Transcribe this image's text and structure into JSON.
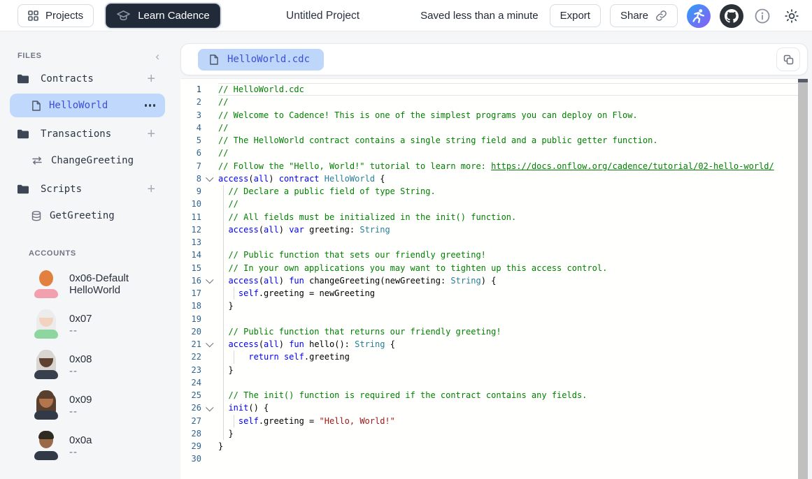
{
  "topbar": {
    "projects_label": "Projects",
    "learn_cadence_label": "Learn Cadence",
    "project_title": "Untitled Project",
    "save_status": "Saved less than a minute",
    "export_label": "Export",
    "share_label": "Share"
  },
  "icons": {
    "plus": "+",
    "collapse_chevron": "‹"
  },
  "sidebar": {
    "files_header": "FILES",
    "accounts_header": "ACCOUNTS",
    "sections": [
      {
        "label": "Contracts",
        "icon": "folder-icon",
        "items": [
          {
            "label": "HelloWorld",
            "icon": "file-icon",
            "selected": true,
            "has_menu": true
          }
        ]
      },
      {
        "label": "Transactions",
        "icon": "folder-icon",
        "items": [
          {
            "label": "ChangeGreeting",
            "icon": "transaction-arrows-icon",
            "selected": false,
            "has_menu": false
          }
        ]
      },
      {
        "label": "Scripts",
        "icon": "folder-icon",
        "items": [
          {
            "label": "GetGreeting",
            "icon": "database-icon",
            "selected": false,
            "has_menu": false
          }
        ]
      }
    ],
    "accounts": [
      {
        "address": "0x06-Default",
        "deployed": "HelloWorld",
        "avatar": {
          "skin": "#e2813f",
          "hair_top": "",
          "hair_back": "",
          "shirt": "#f2a0ae"
        }
      },
      {
        "address": "0x07",
        "deployed": "--",
        "avatar": {
          "skin": "#f3d3c0",
          "hair_top": "#ececec",
          "hair_back": "#ececec",
          "shirt": "#8ed6a0"
        }
      },
      {
        "address": "0x08",
        "deployed": "--",
        "avatar": {
          "skin": "#5f4132",
          "hair_top": "#d9d5d0",
          "hair_back": "#d9d5d0",
          "shirt": "#39404d"
        }
      },
      {
        "address": "0x09",
        "deployed": "--",
        "avatar": {
          "skin": "#b5754c",
          "hair_top": "#59402e",
          "hair_back": "#59402e",
          "shirt": "#333a47"
        }
      },
      {
        "address": "0x0a",
        "deployed": "--",
        "avatar": {
          "skin": "#9a6a48",
          "hair_top": "#2f2a22",
          "hair_back": "",
          "shirt": "#333a47"
        }
      }
    ]
  },
  "editor": {
    "tab_label": "HelloWorld.cdc",
    "active_line": 1,
    "fold_lines": [
      8,
      16,
      21,
      26
    ],
    "guide_l1_lines": [
      9,
      10,
      11,
      12,
      13,
      14,
      15,
      16,
      17,
      18,
      19,
      20,
      21,
      22,
      23,
      24,
      25,
      26,
      27,
      28
    ],
    "guide_l2_lines": [
      17,
      22,
      27
    ],
    "colors": {
      "comment": "#008000",
      "keyword": "#0000ff",
      "type": "#267f99",
      "string": "#a31515",
      "default": "#000000",
      "line_number": "#2f6390",
      "active_line_number": "#13456e",
      "tab_bg": "#bdd6fa",
      "tab_text": "#3b50d6",
      "selected_item_bg": "#bfd8fb",
      "selected_item_text": "#3d4ed8"
    },
    "code_lines": [
      [
        {
          "t": "// HelloWorld.cdc",
          "c": "com"
        }
      ],
      [
        {
          "t": "//",
          "c": "com"
        }
      ],
      [
        {
          "t": "// Welcome to Cadence! This is one of the simplest programs you can deploy on Flow.",
          "c": "com"
        }
      ],
      [
        {
          "t": "//",
          "c": "com"
        }
      ],
      [
        {
          "t": "// The HelloWorld contract contains a single string field and a public getter function.",
          "c": "com"
        }
      ],
      [
        {
          "t": "//",
          "c": "com"
        }
      ],
      [
        {
          "t": "// Follow the \"Hello, World!\" tutorial to learn more: ",
          "c": "com"
        },
        {
          "t": "https://docs.onflow.org/cadence/tutorial/02-hello-world/",
          "c": "link"
        }
      ],
      [
        {
          "t": "access",
          "c": "kw"
        },
        {
          "t": "(",
          "c": "def"
        },
        {
          "t": "all",
          "c": "kw"
        },
        {
          "t": ") ",
          "c": "def"
        },
        {
          "t": "contract",
          "c": "kw"
        },
        {
          "t": " ",
          "c": "def"
        },
        {
          "t": "HelloWorld",
          "c": "typ"
        },
        {
          "t": " {",
          "c": "def"
        }
      ],
      [
        {
          "t": "  ",
          "c": "def"
        },
        {
          "t": "// Declare a public field of type String.",
          "c": "com"
        }
      ],
      [
        {
          "t": "  ",
          "c": "def"
        },
        {
          "t": "//",
          "c": "com"
        }
      ],
      [
        {
          "t": "  ",
          "c": "def"
        },
        {
          "t": "// All fields must be initialized in the init() function.",
          "c": "com"
        }
      ],
      [
        {
          "t": "  ",
          "c": "def"
        },
        {
          "t": "access",
          "c": "kw"
        },
        {
          "t": "(",
          "c": "def"
        },
        {
          "t": "all",
          "c": "kw"
        },
        {
          "t": ") ",
          "c": "def"
        },
        {
          "t": "var",
          "c": "kw"
        },
        {
          "t": " greeting: ",
          "c": "def"
        },
        {
          "t": "String",
          "c": "typ"
        }
      ],
      [],
      [
        {
          "t": "  ",
          "c": "def"
        },
        {
          "t": "// Public function that sets our friendly greeting!",
          "c": "com"
        }
      ],
      [
        {
          "t": "  ",
          "c": "def"
        },
        {
          "t": "// In your own applications you may want to tighten up this access control.",
          "c": "com"
        }
      ],
      [
        {
          "t": "  ",
          "c": "def"
        },
        {
          "t": "access",
          "c": "kw"
        },
        {
          "t": "(",
          "c": "def"
        },
        {
          "t": "all",
          "c": "kw"
        },
        {
          "t": ") ",
          "c": "def"
        },
        {
          "t": "fun",
          "c": "kw"
        },
        {
          "t": " changeGreeting(newGreeting: ",
          "c": "def"
        },
        {
          "t": "String",
          "c": "typ"
        },
        {
          "t": ") {",
          "c": "def"
        }
      ],
      [
        {
          "t": "    ",
          "c": "def"
        },
        {
          "t": "self",
          "c": "kw"
        },
        {
          "t": ".greeting = newGreeting",
          "c": "def"
        }
      ],
      [
        {
          "t": "  }",
          "c": "def"
        }
      ],
      [],
      [
        {
          "t": "  ",
          "c": "def"
        },
        {
          "t": "// Public function that returns our friendly greeting!",
          "c": "com"
        }
      ],
      [
        {
          "t": "  ",
          "c": "def"
        },
        {
          "t": "access",
          "c": "kw"
        },
        {
          "t": "(",
          "c": "def"
        },
        {
          "t": "all",
          "c": "kw"
        },
        {
          "t": ") ",
          "c": "def"
        },
        {
          "t": "fun",
          "c": "kw"
        },
        {
          "t": " hello(): ",
          "c": "def"
        },
        {
          "t": "String",
          "c": "typ"
        },
        {
          "t": " {",
          "c": "def"
        }
      ],
      [
        {
          "t": "      ",
          "c": "def"
        },
        {
          "t": "return",
          "c": "kw"
        },
        {
          "t": " ",
          "c": "def"
        },
        {
          "t": "self",
          "c": "kw"
        },
        {
          "t": ".greeting",
          "c": "def"
        }
      ],
      [
        {
          "t": "  }",
          "c": "def"
        }
      ],
      [],
      [
        {
          "t": "  ",
          "c": "def"
        },
        {
          "t": "// The init() function is required if the contract contains any fields.",
          "c": "com"
        }
      ],
      [
        {
          "t": "  ",
          "c": "def"
        },
        {
          "t": "init",
          "c": "kw"
        },
        {
          "t": "() {",
          "c": "def"
        }
      ],
      [
        {
          "t": "    ",
          "c": "def"
        },
        {
          "t": "self",
          "c": "kw"
        },
        {
          "t": ".greeting = ",
          "c": "def"
        },
        {
          "t": "\"Hello, World!\"",
          "c": "str"
        }
      ],
      [
        {
          "t": "  }",
          "c": "def"
        }
      ],
      [
        {
          "t": "}",
          "c": "def"
        }
      ],
      []
    ]
  }
}
